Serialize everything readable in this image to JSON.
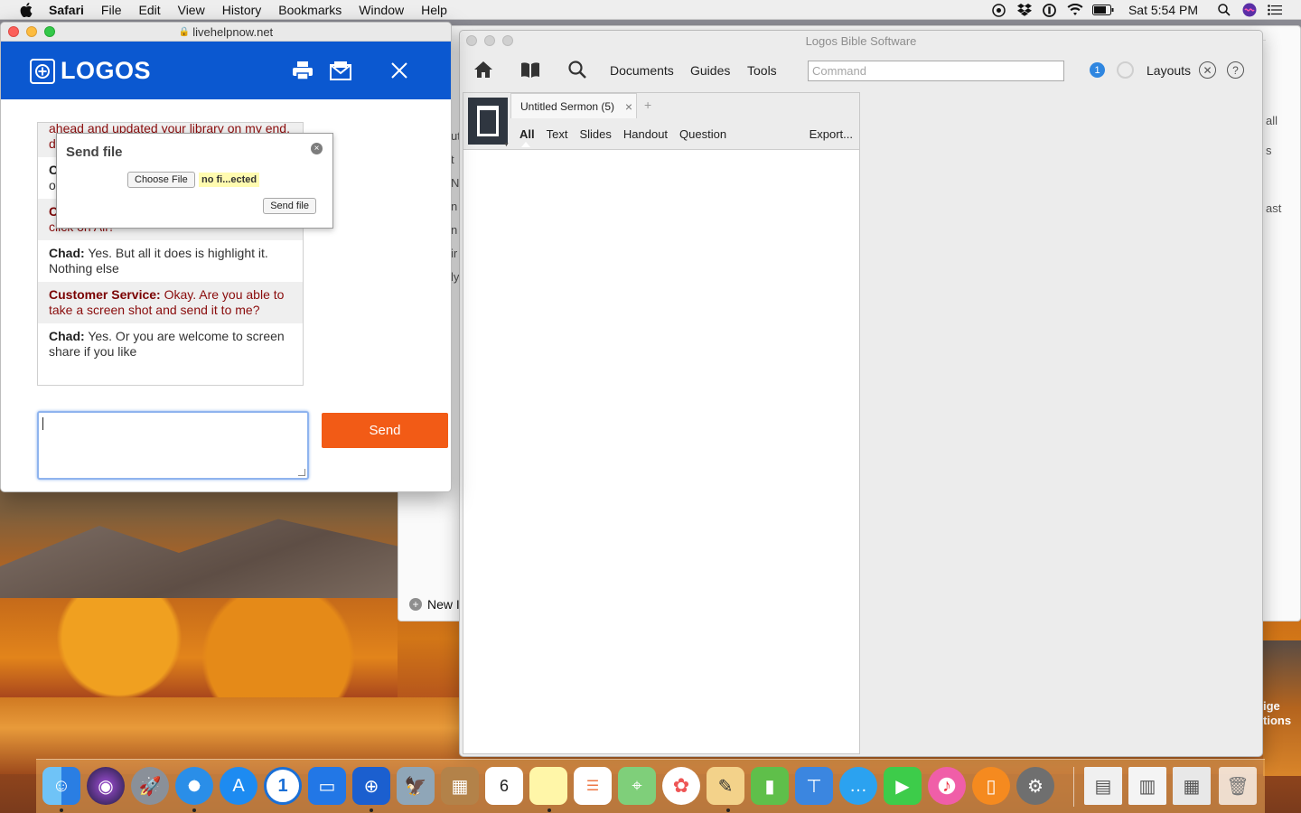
{
  "menubar": {
    "app": "Safari",
    "items": [
      "File",
      "Edit",
      "View",
      "History",
      "Bookmarks",
      "Window",
      "Help"
    ],
    "clock": "Sat 5:54 PM"
  },
  "background_window": {
    "new_button": "New I",
    "side_fragments": [
      "all",
      "s",
      "ast"
    ],
    "left_fragments": [
      "ut",
      "t",
      "N",
      "n",
      "n",
      "ir",
      "ly"
    ]
  },
  "desktop": {
    "fragments": [
      "ige",
      "tions"
    ]
  },
  "chat": {
    "url": "livehelpnow.net",
    "brand": "LOGOS",
    "messages": [
      {
        "type": "cs",
        "speaker": "",
        "text": "ahead and updated your library on my end, d re"
      },
      {
        "type": "user",
        "speaker": "C",
        "text": "o"
      },
      {
        "type": "cs",
        "speaker": "C",
        "text": "click on All?"
      },
      {
        "type": "user",
        "speaker": "Chad:",
        "text": "Yes. But all it does is highlight it. Nothing else"
      },
      {
        "type": "cs",
        "speaker": "Customer Service:",
        "text": "Okay. Are you able to take a screen shot and send it to me?"
      },
      {
        "type": "user",
        "speaker": "Chad:",
        "text": "Yes. Or you are welcome to screen share if you like"
      }
    ],
    "send_label": "Send",
    "popup": {
      "title": "Send file",
      "choose_label": "Choose File",
      "file_name": "no fi...ected",
      "send_file_label": "Send file"
    }
  },
  "logos": {
    "title": "Logos Bible Software",
    "nav": {
      "documents": "Documents",
      "guides": "Guides",
      "tools": "Tools"
    },
    "command_placeholder": "Command",
    "notification_count": "1",
    "layouts_label": "Layouts",
    "document_tab": "Untitled Sermon (5)",
    "view_tabs": [
      "All",
      "Text",
      "Slides",
      "Handout",
      "Question"
    ],
    "export_label": "Export..."
  },
  "colors": {
    "logos_blue": "#0b58d0",
    "send_orange": "#f25b16",
    "cs_red": "#8a0c0c",
    "badge_blue": "#2f86e0"
  }
}
